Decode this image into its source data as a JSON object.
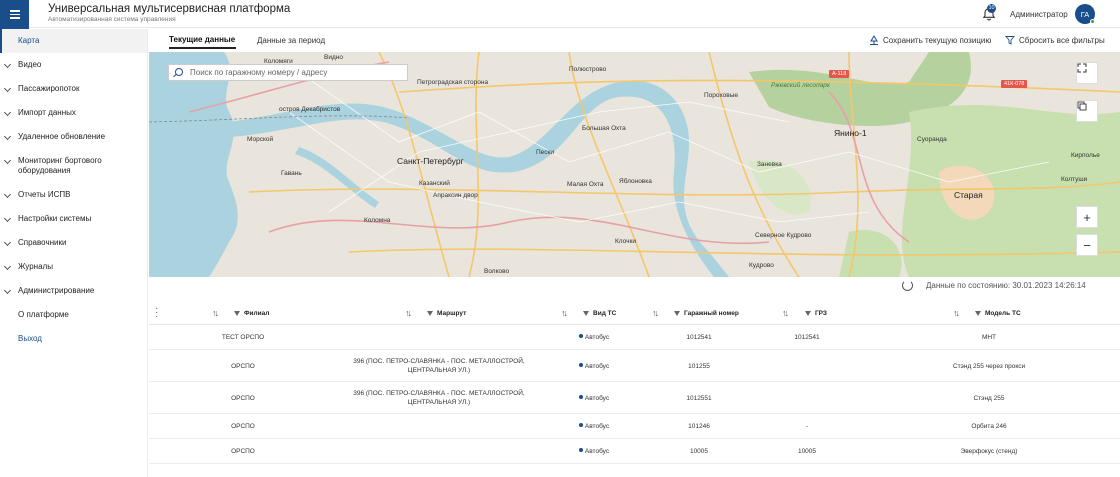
{
  "header": {
    "title": "Универсальная мультисервисная платформа",
    "subtitle": "Автоматизированная система управления",
    "notification_count": "10",
    "user_name": "Администратор",
    "avatar_initials": "ГА",
    "accent_color": "#1a4e8a"
  },
  "sidebar": {
    "items": [
      {
        "label": "Карта",
        "active": true
      },
      {
        "label": "Видео",
        "expandable": true
      },
      {
        "label": "Пассажиропоток",
        "expandable": true
      },
      {
        "label": "Импорт данных",
        "expandable": true
      },
      {
        "label": "Удаленное обновление",
        "expandable": true
      },
      {
        "label": "Мониторинг бортового оборудования",
        "expandable": true
      },
      {
        "label": "Отчеты ИСПВ",
        "expandable": true
      },
      {
        "label": "Настройки системы",
        "expandable": true
      },
      {
        "label": "Справочники",
        "expandable": true
      },
      {
        "label": "Журналы",
        "expandable": true
      },
      {
        "label": "Администрирование",
        "expandable": true
      },
      {
        "label": "О платформе"
      },
      {
        "label": "Выход",
        "link": true
      }
    ]
  },
  "tabs": [
    {
      "label": "Текущие данные",
      "active": true
    },
    {
      "label": "Данные за период"
    }
  ],
  "toolbar": {
    "save_position": "Сохранить текущую позицию",
    "reset_filters": "Сбросить все фильтры"
  },
  "map": {
    "search_placeholder": "Поиск по гаражному номеру / адресу",
    "labels": {
      "kolomyagi": "Коломяги",
      "vidnoe": "Видно",
      "petrogradskaya": "Петроградская сторона",
      "krestovsky": "остров Декабристов",
      "polyustrovo": "Полюстрово",
      "porokhovye": "Пороховые",
      "rzhevsky": "Ржевский лесопарк",
      "yanino": "Янино-1",
      "morskoy": "Морской",
      "bolshaya_okhta": "Большая Охта",
      "spb": "Санкт-Петербург",
      "peski": "Пески",
      "zanevka": "Заневка",
      "suoranda": "Суоранда",
      "kirpolye": "Кирполье",
      "gavan": "Гавань",
      "kazansky": "Казанский",
      "apraksin": "Апраксин двор",
      "malaya_okhta": "Малая Охта",
      "yablonovka": "Яблоновка",
      "kolomna": "Коломна",
      "koltushi": "Колтуши",
      "staraya": "Старая",
      "klochki": "Клочки",
      "severnoe_kudrovo": "Северное Кудрово",
      "kudrovo": "Кудрово",
      "volkovo": "Волково"
    },
    "road_a118": "А-118",
    "road_41k": "41К-078"
  },
  "status": {
    "updated": "Данные по состоянию: 30.01.2023 14:26:14"
  },
  "table": {
    "columns": [
      "Филиал",
      "Маршрут",
      "Вид ТС",
      "Гаражный номер",
      "ГРЗ",
      "Модель ТС"
    ],
    "rows": [
      {
        "branch": "ТЕСТ ОРСПО",
        "route": "",
        "type": "Автобус",
        "garage": "1012541",
        "grz": "1012541",
        "model": "МНТ"
      },
      {
        "branch": "ОРСПО",
        "route": "396 (ПОС. ПЕТРО-СЛАВЯНКА - ПОС. МЕТАЛЛОСТРОЙ, ЦЕНТРАЛЬНАЯ УЛ.)",
        "type": "Автобус",
        "garage": "101255",
        "grz": "",
        "model": "Стэнд 255 через прокси"
      },
      {
        "branch": "ОРСПО",
        "route": "396 (ПОС. ПЕТРО-СЛАВЯНКА - ПОС. МЕТАЛЛОСТРОЙ, ЦЕНТРАЛЬНАЯ УЛ.)",
        "type": "Автобус",
        "garage": "1012551",
        "grz": "",
        "model": "Стэнд 255"
      },
      {
        "branch": "ОРСПО",
        "route": "",
        "type": "Автобус",
        "garage": "101246",
        "grz": "-",
        "model": "Орбита 246"
      },
      {
        "branch": "ОРСПО",
        "route": "",
        "type": "Автобус",
        "garage": "10005",
        "grz": "10005",
        "model": "Эверфокус (стенд)"
      }
    ]
  }
}
